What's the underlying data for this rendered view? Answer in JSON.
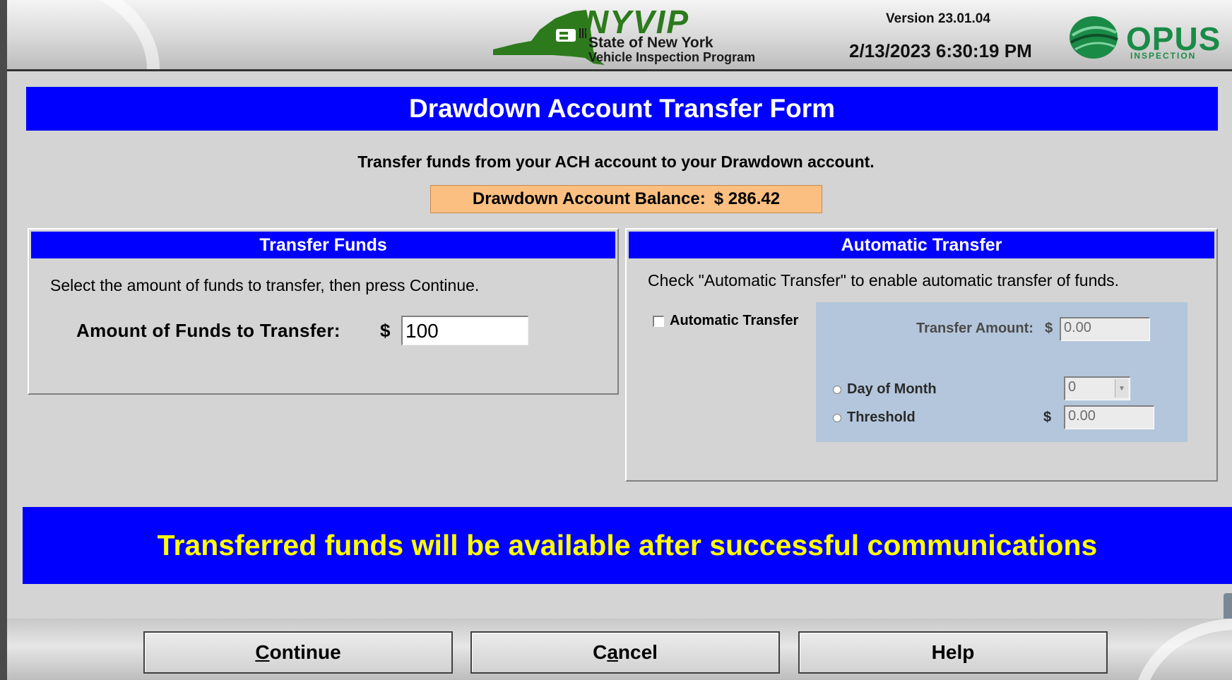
{
  "header": {
    "program_name": "NYVIP",
    "program_line1": "State of New York",
    "program_line2": "Vehicle Inspection Program",
    "version": "Version 23.01.04",
    "datetime": "2/13/2023 6:30:19 PM",
    "vendor_name": "OPUS",
    "vendor_sub": "INSPECTION"
  },
  "form": {
    "title": "Drawdown Account Transfer Form",
    "instructions": "Transfer funds from your ACH account to your Drawdown account.",
    "balance_label": "Drawdown Account Balance:",
    "balance_value": "$ 286.42"
  },
  "transfer_funds": {
    "heading": "Transfer Funds",
    "instructions": "Select the amount of funds to transfer, then press Continue.",
    "amount_label": "Amount of Funds to Transfer:",
    "currency": "$",
    "amount_value": "100"
  },
  "automatic_transfer": {
    "heading": "Automatic Transfer",
    "instructions": "Check \"Automatic Transfer\" to enable automatic transfer of funds.",
    "checkbox_label": "Automatic Transfer",
    "checkbox_checked": false,
    "transfer_amount_label": "Transfer Amount:",
    "currency": "$",
    "transfer_amount_value": "0.00",
    "day_of_month_label": "Day of Month",
    "day_of_month_value": "0",
    "threshold_label": "Threshold",
    "threshold_value": "0.00"
  },
  "notice": "Transferred funds will be available after successful communications",
  "buttons": {
    "continue_pre": "",
    "continue_key": "C",
    "continue_post": "ontinue",
    "cancel_pre": "C",
    "cancel_key": "a",
    "cancel_post": "ncel",
    "help": "Help"
  },
  "colors": {
    "title_bar": "#0000ff",
    "notice_text": "#ffff00",
    "balance_bg": "#fbc081",
    "auto_box_bg": "#b4c6dc",
    "logo_green": "#2d7a1c"
  }
}
